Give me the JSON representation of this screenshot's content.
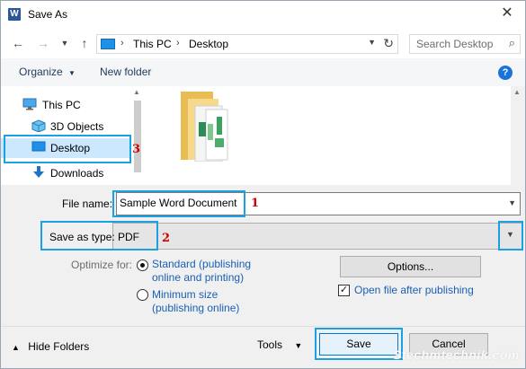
{
  "window": {
    "title": "Save As"
  },
  "nav": {
    "breadcrumb": [
      "This PC",
      "Desktop"
    ],
    "search_placeholder": "Search Desktop"
  },
  "toolbar": {
    "organize": "Organize",
    "new_folder": "New folder",
    "help": "?"
  },
  "sidebar": {
    "items": [
      {
        "label": "This PC",
        "icon": "monitor-icon"
      },
      {
        "label": "3D Objects",
        "icon": "cube-icon"
      },
      {
        "label": "Desktop",
        "icon": "desktop-icon",
        "selected": true
      },
      {
        "label": "Downloads",
        "icon": "download-arrow-icon"
      }
    ]
  },
  "form": {
    "file_name_label": "File name:",
    "file_name_value": "Sample Word Document",
    "save_type_label": "Save as type:",
    "save_type_value": "PDF",
    "optimize_label": "Optimize for:",
    "standard_line1": "Standard (publishing",
    "standard_line2": "online and printing)",
    "minimum_line1": "Minimum size",
    "minimum_line2": "(publishing online)",
    "options_button": "Options...",
    "open_after_label": "Open file after publishing",
    "open_after_checked": true,
    "standard_selected": true
  },
  "annotations": {
    "step1": "1",
    "step2": "2",
    "step3": "3",
    "highlight_color": "#1ba1e2",
    "number_color": "#d10000"
  },
  "footer": {
    "hide_folders": "Hide Folders",
    "tools": "Tools",
    "save": "Save",
    "cancel": "Cancel",
    "watermark": "Stechmtechnik.com"
  }
}
